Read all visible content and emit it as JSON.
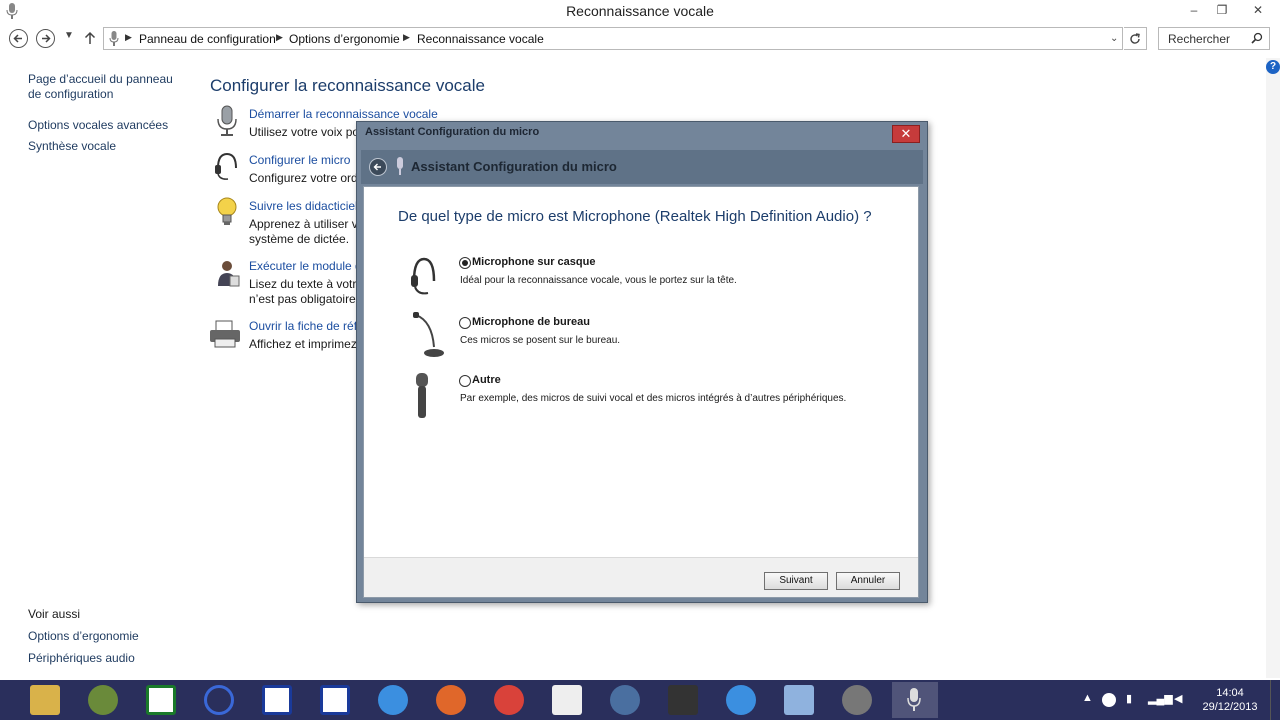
{
  "window": {
    "title": "Reconnaissance vocale",
    "minimize": "–",
    "maximize": "❐",
    "close": "✕"
  },
  "address": {
    "crumbs": [
      "Panneau de configuration",
      "Options d’ergonomie",
      "Reconnaissance vocale"
    ],
    "search_placeholder": "Rechercher"
  },
  "left_pane": {
    "home": "Page d’accueil du panneau de configuration",
    "links": [
      "Options vocales avancées",
      "Synthèse vocale"
    ]
  },
  "main": {
    "title": "Configurer la reconnaissance vocale",
    "tasks": [
      {
        "link": "Démarrer la reconnaissance vocale",
        "desc": "Utilisez votre voix pour contrôler votre ordinateur.",
        "icon": "microphone-icon"
      },
      {
        "link": "Configurer le micro",
        "desc": "Configurez votre ordinateur pour qu’il fonctionne correctement avec la reconnaissance vocale.",
        "icon": "headset-icon"
      },
      {
        "link": "Suivre les didacticiels de la reconnaissance vocale",
        "desc": "Apprenez à utiliser votre ordinateur avec la voix. Apprenez les commandes de base et le système de dictée.",
        "icon": "lightbulb-icon"
      },
      {
        "link": "Exécuter le module d’apprentissage de votre voix",
        "desc": "Lisez du texte à votre ordinateur afin que celui-ci s’habitue à votre voix. Cette opération n’est pas obligatoire, mais elle améliore la précision de la dictée.",
        "icon": "person-icon"
      },
      {
        "link": "Ouvrir la fiche de référence vocale",
        "desc": "Affichez et imprimez une liste de commandes courantes à conserver avec vous.",
        "icon": "printer-icon"
      }
    ]
  },
  "see_also": {
    "heading": "Voir aussi",
    "links": [
      "Options d’ergonomie",
      "Périphériques audio"
    ]
  },
  "dialog": {
    "title": "Assistant Configuration du micro",
    "header": "Assistant Configuration du micro",
    "question": "De quel type de micro est Microphone (Realtek High Definition Audio) ?",
    "options": [
      {
        "label": "Microphone sur casque",
        "desc": "Idéal pour la reconnaissance vocale, vous le portez sur la tête.",
        "checked": true,
        "icon": "headset-mic-icon"
      },
      {
        "label": "Microphone de bureau",
        "desc": "Ces micros se posent sur le bureau.",
        "checked": false,
        "icon": "desk-mic-icon"
      },
      {
        "label": "Autre",
        "desc": "Par exemple, des micros de suivi vocal et des micros intégrés à d’autres périphériques.",
        "checked": false,
        "icon": "handheld-mic-icon"
      }
    ],
    "next": "Suivant",
    "cancel": "Annuler"
  },
  "taskbar": {
    "time": "14:04",
    "date": "29/12/2013",
    "colors": {
      "bar": "#2a2f5c",
      "accent": "#1c63c4"
    }
  }
}
